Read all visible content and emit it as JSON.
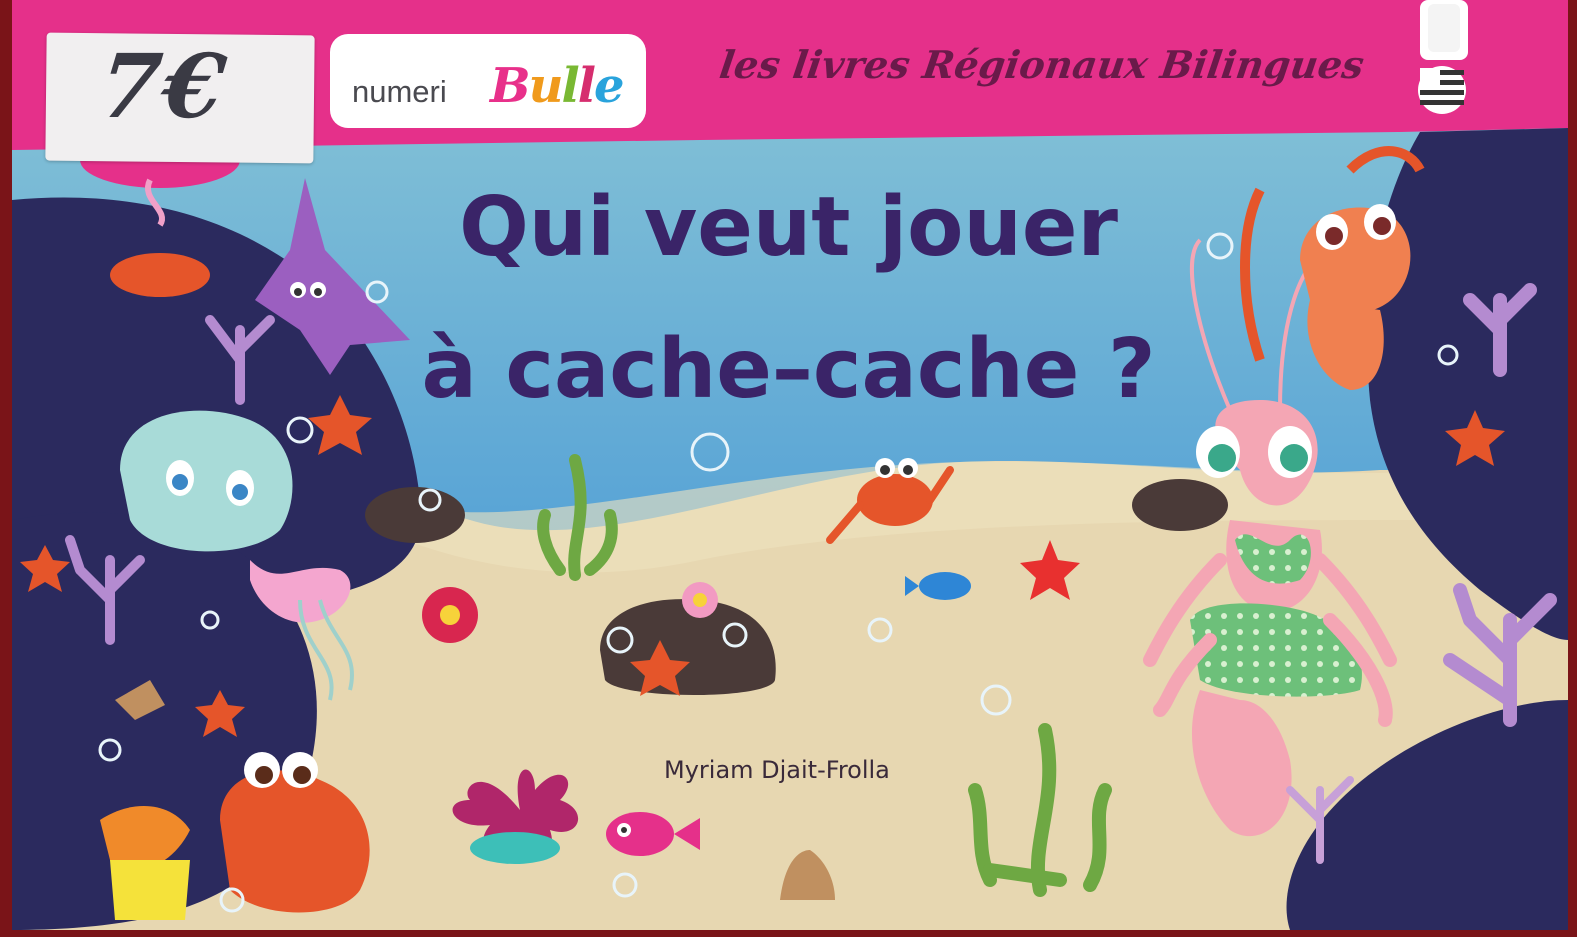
{
  "price": "7€",
  "publisher": {
    "name_part1": "numeri",
    "name_part2_letters": [
      "B",
      "u",
      "l",
      "l",
      "e"
    ],
    "colors": [
      "#e8308a",
      "#f09a1c",
      "#79b833",
      "#d62d6e",
      "#29a3dc"
    ]
  },
  "series": "les livres Régionaux Bilingues",
  "flags": [
    "french-flag-icon",
    "breton-flag-icon"
  ],
  "title_line1": "Qui veut jouer",
  "title_line2": "à cache–cache ?",
  "author": "Myriam Djait-Frolla",
  "colors": {
    "band": "#e5308a",
    "sea": "#6fb3d8",
    "sand": "#e7d7b1",
    "rocks": "#2b2a5e",
    "title": "#3a2468"
  }
}
